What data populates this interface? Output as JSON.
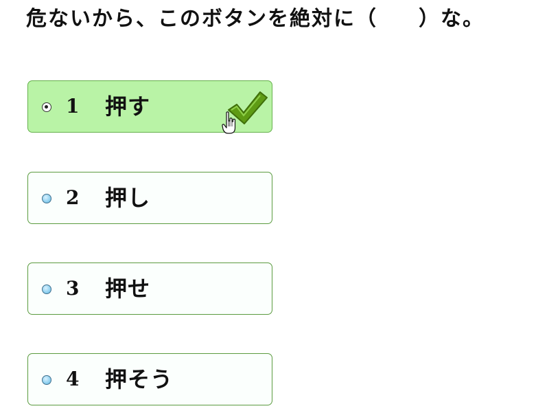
{
  "question": {
    "before": "危ないから、このボタンを絶対に（",
    "after": "）な。"
  },
  "choices": [
    {
      "number": "1",
      "text": "押す",
      "selected": true
    },
    {
      "number": "2",
      "text": "押し",
      "selected": false
    },
    {
      "number": "3",
      "text": "押せ",
      "selected": false
    },
    {
      "number": "4",
      "text": "押そう",
      "selected": false
    }
  ],
  "colors": {
    "selected_background": "#b9f3a6",
    "border": "#5a9a3e",
    "check": "#5e9b14",
    "radio": "#8fd0ef"
  },
  "icons": {
    "selected_mark": "checkmark-icon",
    "pointer": "hand-cursor-icon"
  }
}
